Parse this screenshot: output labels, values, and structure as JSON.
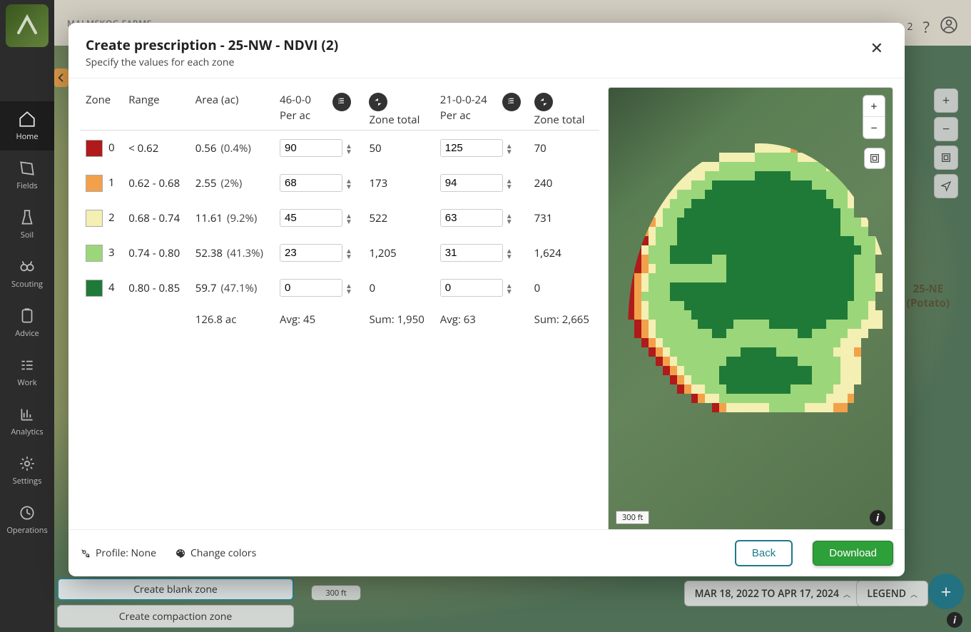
{
  "farm": {
    "name": "MALMSKOG FARMS"
  },
  "topbar": {
    "counter": "2"
  },
  "sidebar": {
    "items": [
      {
        "label": "Home"
      },
      {
        "label": "Fields"
      },
      {
        "label": "Soil"
      },
      {
        "label": "Scouting"
      },
      {
        "label": "Advice"
      },
      {
        "label": "Work"
      },
      {
        "label": "Analytics"
      },
      {
        "label": "Settings"
      },
      {
        "label": "Operations"
      }
    ]
  },
  "bg": {
    "neighbor_label_line1": "25-NE",
    "neighbor_label_line2": "(Potato)",
    "create_blank": "Create blank zone",
    "create_compaction": "Create compaction zone",
    "date_range": "MAR 18, 2022 TO APR 17, 2024",
    "legend": "LEGEND",
    "scale": "300 ft"
  },
  "modal": {
    "title": "Create prescription - 25-NW - NDVI (2)",
    "subtitle": "Specify the values for each zone",
    "headers": {
      "zone": "Zone",
      "range": "Range",
      "area": "Area (ac)",
      "prod1": "46-0-0",
      "per_ac": "Per ac",
      "zone_total": "Zone total",
      "prod2": "21-0-0-24"
    },
    "zones": [
      {
        "idx": "0",
        "color": "#b01a1a",
        "range": "< 0.62",
        "area": "0.56",
        "pct": "(0.4%)",
        "p1_per": "90",
        "p1_tot": "50",
        "p2_per": "125",
        "p2_tot": "70"
      },
      {
        "idx": "1",
        "color": "#f2a14a",
        "range": "0.62 - 0.68",
        "area": "2.55",
        "pct": "(2%)",
        "p1_per": "68",
        "p1_tot": "173",
        "p2_per": "94",
        "p2_tot": "240"
      },
      {
        "idx": "2",
        "color": "#f4efb2",
        "range": "0.68 - 0.74",
        "area": "11.61",
        "pct": "(9.2%)",
        "p1_per": "45",
        "p1_tot": "522",
        "p2_per": "63",
        "p2_tot": "731"
      },
      {
        "idx": "3",
        "color": "#9cd67a",
        "range": "0.74 - 0.80",
        "area": "52.38",
        "pct": "(41.3%)",
        "p1_per": "23",
        "p1_tot": "1,205",
        "p2_per": "31",
        "p2_tot": "1,624"
      },
      {
        "idx": "4",
        "color": "#1f7a38",
        "range": "0.80 - 0.85",
        "area": "59.7",
        "pct": "(47.1%)",
        "p1_per": "0",
        "p1_tot": "0",
        "p2_per": "0",
        "p2_tot": "0"
      }
    ],
    "totals": {
      "area": "126.8 ac",
      "p1_avg": "Avg: 45",
      "p1_sum": "Sum: 1,950",
      "p2_avg": "Avg: 63",
      "p2_sum": "Sum: 2,665"
    },
    "map": {
      "scale": "300 ft"
    },
    "footer": {
      "profile_label": "Profile: None",
      "change_colors": "Change colors",
      "back": "Back",
      "download": "Download"
    }
  }
}
